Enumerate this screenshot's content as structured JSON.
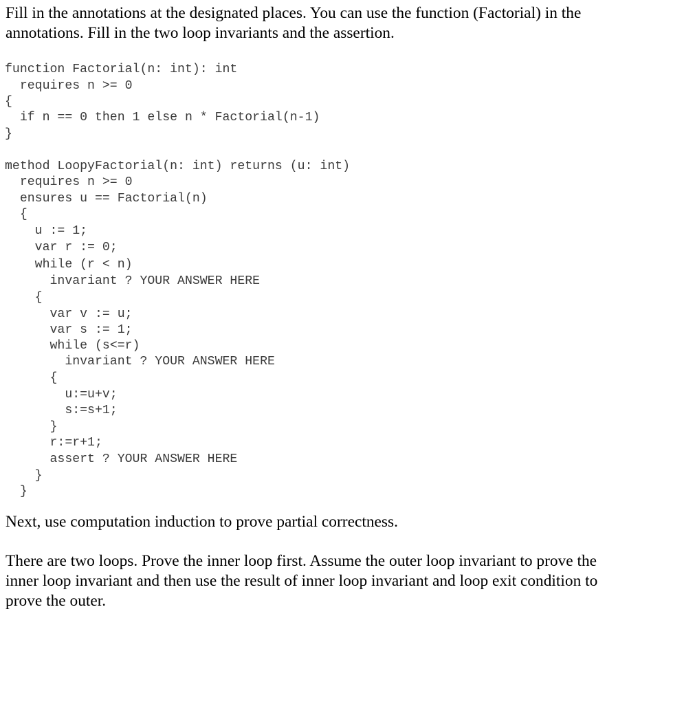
{
  "intro": {
    "line1": "Fill in the annotations at the designated places. You can use the function (Factorial) in the",
    "line2": "annotations. Fill in the two loop invariants and the assertion."
  },
  "code": {
    "function_block": [
      "function Factorial(n: int): int",
      "  requires n >= 0",
      "{",
      "  if n == 0 then 1 else n * Factorial(n-1)",
      "}"
    ],
    "method_block": [
      "method LoopyFactorial(n: int) returns (u: int)",
      "  requires n >= 0",
      "  ensures u == Factorial(n)",
      "  {",
      "    u := 1;",
      "    var r := 0;",
      "    while (r < n)",
      "      invariant ? YOUR ANSWER HERE",
      "    {",
      "      var v := u;",
      "      var s := 1;",
      "      while (s<=r)",
      "        invariant ? YOUR ANSWER HERE",
      "      {",
      "        u:=u+v;",
      "        s:=s+1;",
      "      }",
      "      r:=r+1;",
      "      assert ? YOUR ANSWER HERE",
      "    }",
      "  }"
    ]
  },
  "next": {
    "text": "Next, use computation induction to prove partial correctness."
  },
  "two_loops": {
    "line1": "There are two loops. Prove the inner loop first. Assume the outer loop invariant to prove the",
    "line2": "inner loop invariant and then use the result of inner loop invariant and loop exit condition to",
    "line3": "prove the outer."
  }
}
